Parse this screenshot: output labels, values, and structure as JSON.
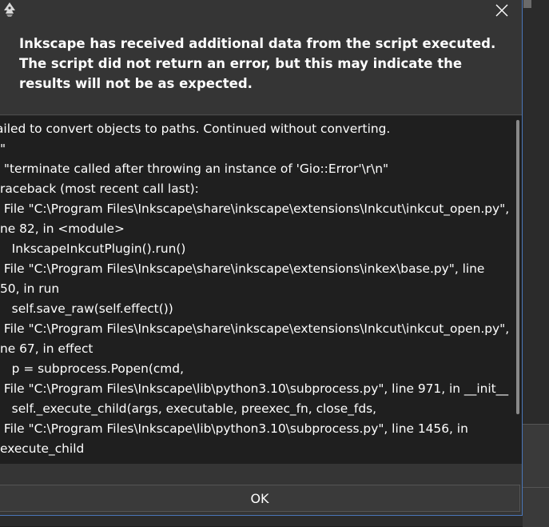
{
  "dialog": {
    "header_message": "Inkscape has received additional data from the script executed.  The script did not return an error, but this may indicate the results will not be as expected.",
    "ok_label": "OK",
    "close_icon": "close-icon",
    "app_icon": "inkscape-icon"
  },
  "log": {
    "lines": [
      "ailed to convert objects to paths. Continued without converting.",
      "\"",
      " \"terminate called after throwing an instance of 'Gio::Error'\\r\\n\"",
      "raceback (most recent call last):",
      " File \"C:\\Program Files\\Inkscape\\share\\inkscape\\extensions\\Inkcut\\inkcut_open.py\",",
      "ne 82, in <module>",
      "   InkscapeInkcutPlugin().run()",
      " File \"C:\\Program Files\\Inkscape\\share\\inkscape\\extensions\\inkex\\base.py\", line",
      "50, in run",
      "   self.save_raw(self.effect())",
      " File \"C:\\Program Files\\Inkscape\\share\\inkscape\\extensions\\Inkcut\\inkcut_open.py\",",
      "ne 67, in effect",
      "   p = subprocess.Popen(cmd,",
      " File \"C:\\Program Files\\Inkscape\\lib\\python3.10\\subprocess.py\", line 971, in __init__",
      "   self._execute_child(args, executable, preexec_fn, close_fds,",
      " File \"C:\\Program Files\\Inkscape\\lib\\python3.10\\subprocess.py\", line 1456, in",
      "execute_child"
    ]
  }
}
